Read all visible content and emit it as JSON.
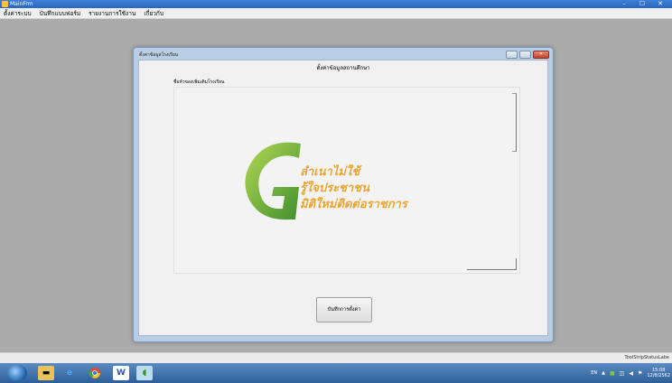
{
  "window": {
    "title": "MainFrm",
    "minimize_glyph": "–",
    "maximize_glyph": "☐",
    "close_glyph": "✕"
  },
  "menu": {
    "items": [
      {
        "label": "ตั้งค่าระบบ"
      },
      {
        "label": "บันทึกแบบฟอร์ม"
      },
      {
        "label": "รายงานการใช้งาน"
      },
      {
        "label": "เกี่ยวกับ"
      }
    ]
  },
  "dialog": {
    "title": "ตั้งค่าข้อมูลโรงเรียน",
    "heading": "ตั้งค่าข้อมูลสถานศึกษา",
    "field_label": "ชื่อหัวของเพิ่มเติมโรงเรียน",
    "slogan": {
      "line1": "ลำเนาไม่ใช้",
      "line2": "รู้ใจประชาชน",
      "line3": "มิติใหม่ติดต่อราชการ"
    },
    "save_button": "บันทึกการตั้งค่า"
  },
  "statusbar": {
    "label": "ToolStripStatusLabe"
  },
  "taskbar": {
    "word_label": "W",
    "lang": "EN",
    "time": "15:08",
    "date": "12/8/2562"
  },
  "colors": {
    "logo_green_light": "#a8cf4a",
    "logo_green_dark": "#3f8f2c",
    "slogan_orange": "#e9a531",
    "titlebar_blue": "#2a64c0"
  }
}
